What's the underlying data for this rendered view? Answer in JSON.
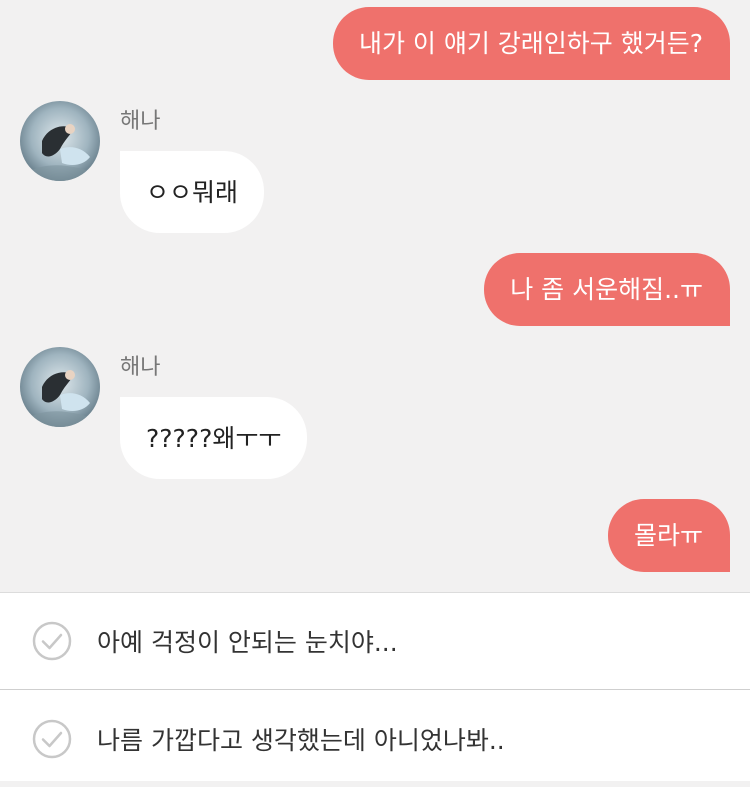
{
  "colors": {
    "outgoing_bubble": "#ef716c",
    "incoming_bubble": "#ffffff",
    "chat_background": "#f2f1f1"
  },
  "messages": [
    {
      "direction": "outgoing",
      "text": "내가 이 얘기 강래인하구 했거든?"
    },
    {
      "direction": "incoming",
      "sender": "해나",
      "text": "ㅇㅇ뭐래"
    },
    {
      "direction": "outgoing",
      "text": "나 좀 서운해짐..ㅠ"
    },
    {
      "direction": "incoming",
      "sender": "해나",
      "text": "?????왜ㅜㅜ"
    },
    {
      "direction": "outgoing",
      "text": "몰라ㅠ"
    }
  ],
  "reply_options": [
    {
      "icon": "check-circle-icon",
      "text": "아예 걱정이 안되는 눈치야..."
    },
    {
      "icon": "check-circle-icon",
      "text": "나름 가깝다고 생각했는데 아니었나봐.."
    }
  ]
}
